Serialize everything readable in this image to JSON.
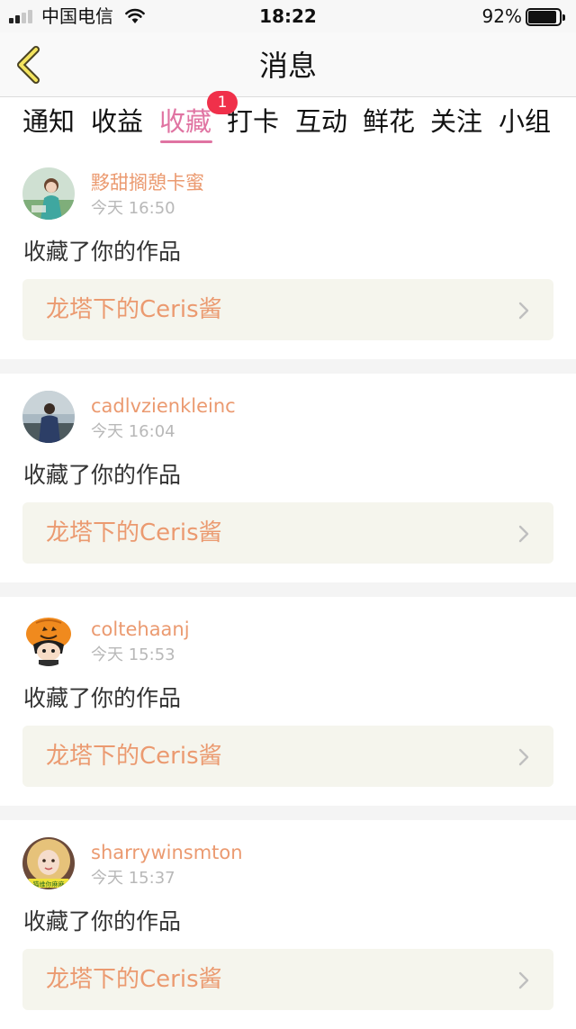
{
  "status_bar": {
    "carrier": "中国电信",
    "time": "18:22",
    "battery_percent": "92%",
    "battery_level": 0.92,
    "signal_bars": 2
  },
  "nav": {
    "title": "消息"
  },
  "tabs": [
    {
      "label": "通知",
      "active": false
    },
    {
      "label": "收益",
      "active": false
    },
    {
      "label": "收藏",
      "active": true,
      "badge": "1"
    },
    {
      "label": "打卡",
      "active": false
    },
    {
      "label": "互动",
      "active": false
    },
    {
      "label": "鲜花",
      "active": false
    },
    {
      "label": "关注",
      "active": false
    },
    {
      "label": "小组",
      "active": false
    }
  ],
  "colors": {
    "accent_pink": "#e074a2",
    "username_orange": "#eb9a70",
    "badge_red": "#f0304a",
    "work_box_bg": "#f5f5ed"
  },
  "messages": [
    {
      "username": "黟甜搁憩卡蜜",
      "time": "今天 16:50",
      "action": "收藏了你的作品",
      "work_title": "龙塔下的Ceris酱",
      "avatar_icon": "girl-photo-avatar"
    },
    {
      "username": "cadlvzienkleinc",
      "time": "今天 16:04",
      "action": "收藏了你的作品",
      "work_title": "龙塔下的Ceris酱",
      "avatar_icon": "person-by-sea-avatar"
    },
    {
      "username": "coltehaanj",
      "time": "今天 15:53",
      "action": "收藏了你的作品",
      "work_title": "龙塔下的Ceris酱",
      "avatar_icon": "pumpkin-hat-cartoon-avatar"
    },
    {
      "username": "sharrywinsmton",
      "time": "今天 15:37",
      "action": "收藏了你的作品",
      "work_title": "龙塔下的Ceris酱",
      "avatar_icon": "blonde-girl-photo-avatar",
      "avatar_caption": "猫维你麻麻"
    }
  ]
}
